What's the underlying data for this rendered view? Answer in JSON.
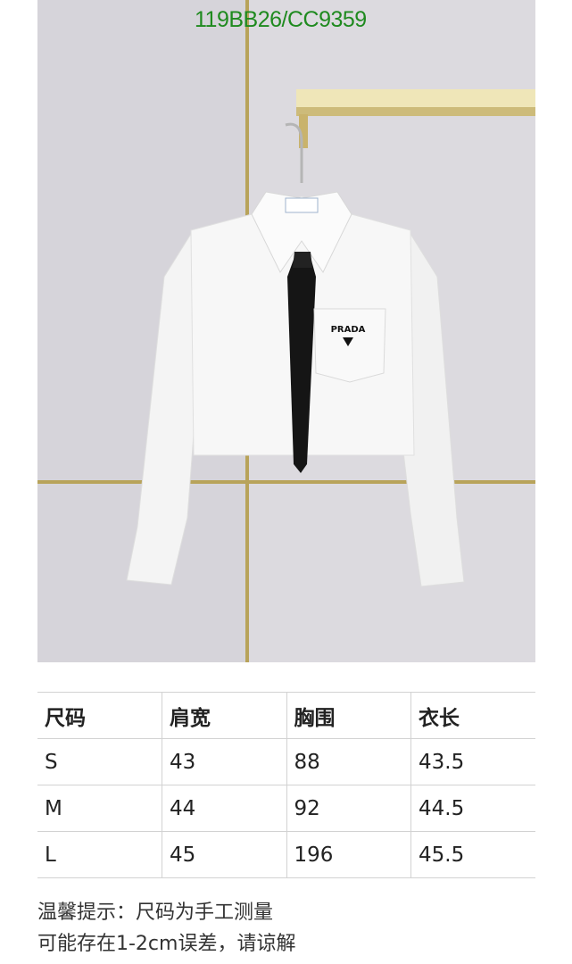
{
  "watermark": "119BB26/CC9359",
  "product_photo": {
    "alt": "White cropped shirt with black tie on hanger",
    "logo_text": "PRADA"
  },
  "size_table": {
    "headers": [
      "尺码",
      "肩宽",
      "胸围",
      "衣长"
    ],
    "rows": [
      [
        "S",
        "43",
        "88",
        "43.5"
      ],
      [
        "M",
        "44",
        "92",
        "44.5"
      ],
      [
        "L",
        "45",
        "196",
        "45.5"
      ]
    ]
  },
  "note": {
    "line1": "温馨提示：尺码为手工测量",
    "line2": "可能存在1-2cm误差，请谅解"
  }
}
